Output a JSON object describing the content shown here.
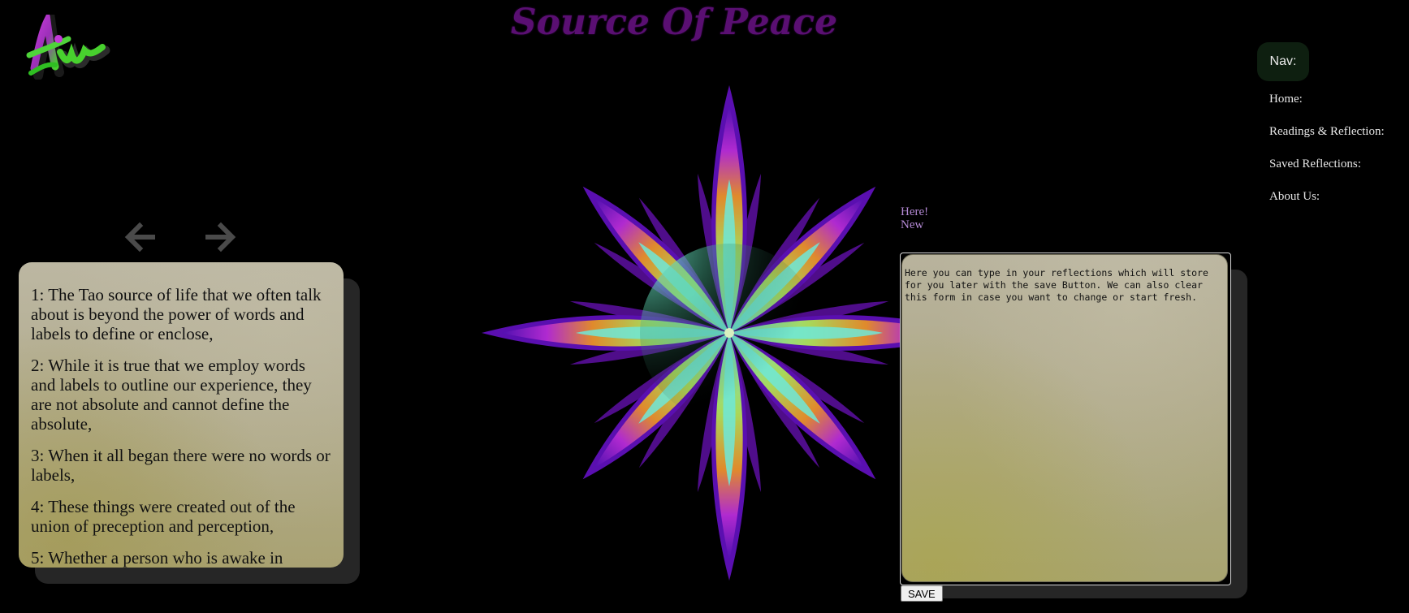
{
  "site": {
    "title": "Source Of Peace",
    "logo_icon": "aiw-logo-icon"
  },
  "pager": {
    "prev_icon": "arrow-left-icon",
    "next_icon": "arrow-right-icon"
  },
  "reading": {
    "verses": [
      "1: The Tao source of life that we often talk about is beyond the power of words and labels to define or enclose,",
      "2: While it is true that we employ words and labels to outline our experience, they are not absolute and cannot define the absolute,",
      "3: When it all began there were no words or labels,",
      "4: These things were created out of the union of preception and perception,",
      "5: Whether a person who is awake in"
    ]
  },
  "reflection": {
    "label_line1": "Here!",
    "label_line2": "New",
    "text": "Here you can type in your reflections which will store for you later with the save Button. We can also clear this form in case you want to change or start fresh.",
    "save_label": "SAVE"
  },
  "nav": {
    "title": "Nav:",
    "items": [
      {
        "label": "Home:"
      },
      {
        "label": "Readings & Reflection:"
      },
      {
        "label": "Saved Reflections:"
      },
      {
        "label": "About Us:"
      }
    ]
  },
  "colors": {
    "background": "#000000",
    "title": "#5a0f72",
    "accent_purple": "#b58ad6",
    "nav_badge": "#0e1f10"
  }
}
